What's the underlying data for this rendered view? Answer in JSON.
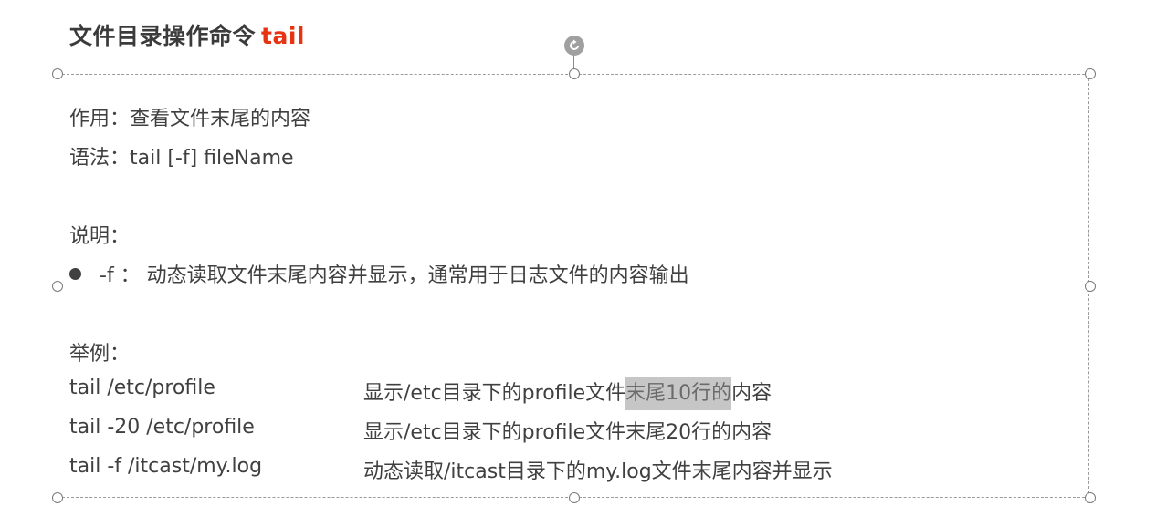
{
  "title": {
    "prefix": "文件目录操作命令",
    "command": "tail"
  },
  "content": {
    "purpose": "作用：查看文件末尾的内容",
    "syntax": "语法：tail [-f] fileName",
    "explain_label": "说明：",
    "options": [
      {
        "text": "-f ： 动态读取文件末尾内容并显示，通常用于日志文件的内容输出"
      }
    ],
    "example_label": "举例：",
    "examples": [
      {
        "command": "tail /etc/profile",
        "desc_before": "显示/etc目录下的profile文件",
        "desc_highlight": "末尾10行的",
        "desc_after": "内容"
      },
      {
        "command": "tail -20 /etc/profile",
        "desc": "显示/etc目录下的profile文件末尾20行的内容"
      },
      {
        "command": "tail -f /itcast/my.log",
        "desc": "动态读取/itcast目录下的my.log文件末尾内容并显示"
      }
    ]
  },
  "colors": {
    "title_accent": "#e63312",
    "body_text": "#404040",
    "selection_highlight": "#c6c6c6"
  }
}
